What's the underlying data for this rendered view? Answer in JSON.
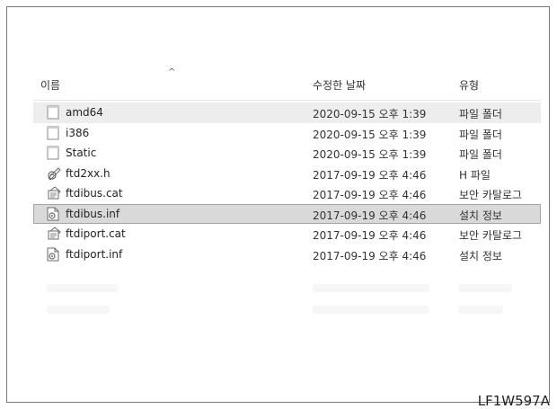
{
  "header": {
    "name": "이름",
    "date": "수정한 날짜",
    "type": "유형",
    "sort_icon": "chevron-up-icon"
  },
  "files": [
    {
      "name": "amd64",
      "date": "2020-09-15 오후 1:39",
      "type": "파일 폴더",
      "icon": "folder-icon",
      "state": "alt"
    },
    {
      "name": "i386",
      "date": "2020-09-15 오후 1:39",
      "type": "파일 폴더",
      "icon": "folder-icon",
      "state": ""
    },
    {
      "name": "Static",
      "date": "2020-09-15 오후 1:39",
      "type": "파일 폴더",
      "icon": "folder-icon",
      "state": ""
    },
    {
      "name": "ftd2xx.h",
      "date": "2017-09-19 오후 4:46",
      "type": "H 파일",
      "icon": "header-file-icon",
      "state": ""
    },
    {
      "name": "ftdibus.cat",
      "date": "2017-09-19 오후 4:46",
      "type": "보안 카탈로그",
      "icon": "security-catalog-icon",
      "state": ""
    },
    {
      "name": "ftdibus.inf",
      "date": "2017-09-19 오후 4:46",
      "type": "설치 정보",
      "icon": "setup-info-icon",
      "state": "selected"
    },
    {
      "name": "ftdiport.cat",
      "date": "2017-09-19 오후 4:46",
      "type": "보안 카탈로그",
      "icon": "security-catalog-icon",
      "state": ""
    },
    {
      "name": "ftdiport.inf",
      "date": "2017-09-19 오후 4:46",
      "type": "설치 정보",
      "icon": "setup-info-icon",
      "state": ""
    }
  ],
  "caption": "LF1W597A",
  "colors": {
    "selected_row": "#d9d9d9",
    "alt_row": "#ededed",
    "border": "#777777"
  }
}
